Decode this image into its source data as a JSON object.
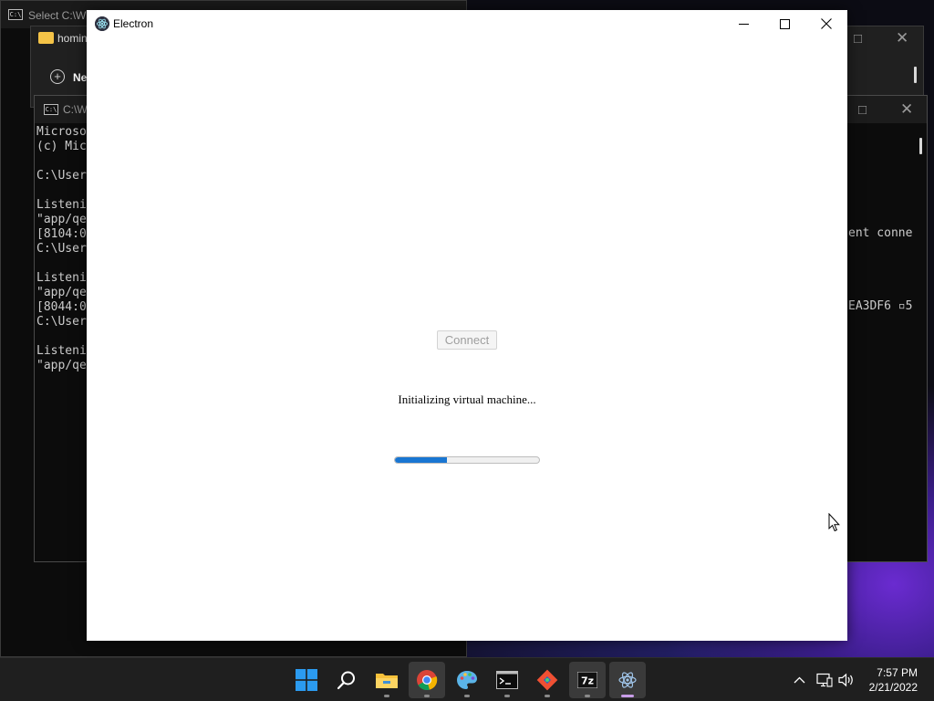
{
  "background_windows": {
    "select_cmd": {
      "title": "Select C:\\Wi"
    },
    "explorer": {
      "folder_label": "homin",
      "new_label": "Ne"
    },
    "cmd2": {
      "title": "C:\\Wi",
      "lines": [
        "Microso",
        "(c) Mic",
        "",
        "C:\\User",
        "",
        "Listeni",
        "\"app/qe",
        "[8104:0",
        "C:\\User",
        "",
        "Listeni",
        "\"app/qe",
        "[8044:0",
        "C:\\User",
        "",
        "Listeni",
        "\"app/qe"
      ],
      "right_text_1": "ent conne",
      "right_text_2": "EA3DF6 ▫5"
    }
  },
  "electron_window": {
    "title": "Electron",
    "connect_button_label": "Connect",
    "status_text": "Initializing virtual machine...",
    "progress": 0.36
  },
  "taskbar": {
    "apps": [
      "start",
      "search",
      "file-explorer",
      "chrome",
      "paint",
      "terminal",
      "git",
      "7zip",
      "electron"
    ],
    "clock_time": "7:57 PM",
    "clock_date": "2/21/2022"
  },
  "colors": {
    "accent": "#1976d2",
    "taskbar": "#1f1f1f",
    "window_bg": "#ffffff"
  }
}
